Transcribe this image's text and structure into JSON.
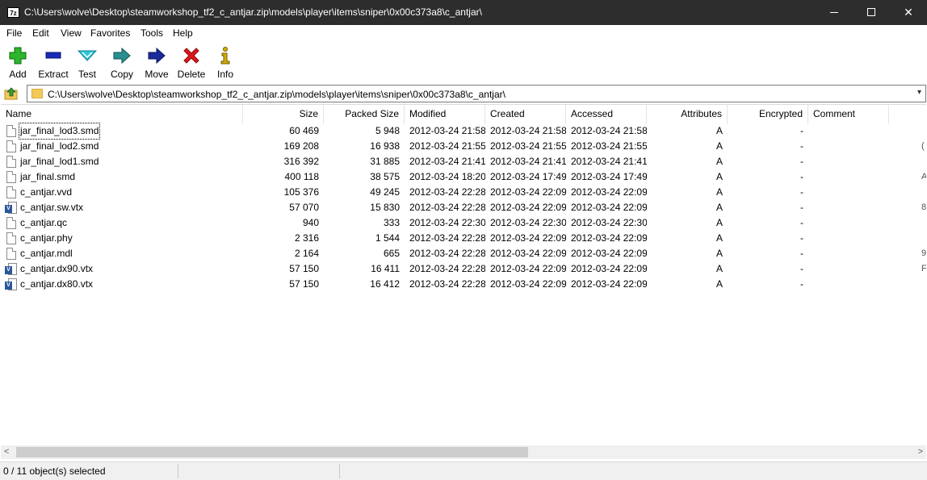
{
  "window": {
    "title": "C:\\Users\\wolve\\Desktop\\steamworkshop_tf2_c_antjar.zip\\models\\player\\items\\sniper\\0x00c373a8\\c_antjar\\",
    "app_icon_text": "7z"
  },
  "menu": [
    "File",
    "Edit",
    "View",
    "Favorites",
    "Tools",
    "Help"
  ],
  "toolbar": [
    {
      "label": "Add",
      "icon": "plus-icon",
      "color": "#2db52d"
    },
    {
      "label": "Extract",
      "icon": "minus-icon",
      "color": "#1a2bb8"
    },
    {
      "label": "Test",
      "icon": "check-icon",
      "color": "#2fc6d9"
    },
    {
      "label": "Copy",
      "icon": "copy-arrow-icon",
      "color": "#2a8f8f"
    },
    {
      "label": "Move",
      "icon": "move-arrow-icon",
      "color": "#1a2b9a"
    },
    {
      "label": "Delete",
      "icon": "delete-x-icon",
      "color": "#e0181c"
    },
    {
      "label": "Info",
      "icon": "info-icon",
      "color": "#d4b000"
    }
  ],
  "address": {
    "path": "C:\\Users\\wolve\\Desktop\\steamworkshop_tf2_c_antjar.zip\\models\\player\\items\\sniper\\0x00c373a8\\c_antjar\\"
  },
  "columns": [
    "Name",
    "Size",
    "Packed Size",
    "Modified",
    "Created",
    "Accessed",
    "Attributes",
    "Encrypted",
    "Comment"
  ],
  "files": [
    {
      "name": "jar_final_lod3.smd",
      "size": "60 469",
      "packed": "5 948",
      "modified": "2012-03-24 21:58",
      "created": "2012-03-24 21:58",
      "accessed": "2012-03-24 21:58",
      "attributes": "A",
      "encrypted": "-",
      "icon": "file-icon",
      "clip": ""
    },
    {
      "name": "jar_final_lod2.smd",
      "size": "169 208",
      "packed": "16 938",
      "modified": "2012-03-24 21:55",
      "created": "2012-03-24 21:55",
      "accessed": "2012-03-24 21:55",
      "attributes": "A",
      "encrypted": "-",
      "icon": "file-icon",
      "clip": "("
    },
    {
      "name": "jar_final_lod1.smd",
      "size": "316 392",
      "packed": "31 885",
      "modified": "2012-03-24 21:41",
      "created": "2012-03-24 21:41",
      "accessed": "2012-03-24 21:41",
      "attributes": "A",
      "encrypted": "-",
      "icon": "file-icon",
      "clip": ""
    },
    {
      "name": "jar_final.smd",
      "size": "400 118",
      "packed": "38 575",
      "modified": "2012-03-24 18:20",
      "created": "2012-03-24 17:49",
      "accessed": "2012-03-24 17:49",
      "attributes": "A",
      "encrypted": "-",
      "icon": "file-icon",
      "clip": "A"
    },
    {
      "name": "c_antjar.vvd",
      "size": "105 376",
      "packed": "49 245",
      "modified": "2012-03-24 22:28",
      "created": "2012-03-24 22:09",
      "accessed": "2012-03-24 22:09",
      "attributes": "A",
      "encrypted": "-",
      "icon": "file-icon",
      "clip": ""
    },
    {
      "name": "c_antjar.sw.vtx",
      "size": "57 070",
      "packed": "15 830",
      "modified": "2012-03-24 22:28",
      "created": "2012-03-24 22:09",
      "accessed": "2012-03-24 22:09",
      "attributes": "A",
      "encrypted": "-",
      "icon": "vs-icon",
      "clip": "8"
    },
    {
      "name": "c_antjar.qc",
      "size": "940",
      "packed": "333",
      "modified": "2012-03-24 22:30",
      "created": "2012-03-24 22:30",
      "accessed": "2012-03-24 22:30",
      "attributes": "A",
      "encrypted": "-",
      "icon": "file-icon",
      "clip": ""
    },
    {
      "name": "c_antjar.phy",
      "size": "2 316",
      "packed": "1 544",
      "modified": "2012-03-24 22:28",
      "created": "2012-03-24 22:09",
      "accessed": "2012-03-24 22:09",
      "attributes": "A",
      "encrypted": "-",
      "icon": "file-icon",
      "clip": ""
    },
    {
      "name": "c_antjar.mdl",
      "size": "2 164",
      "packed": "665",
      "modified": "2012-03-24 22:28",
      "created": "2012-03-24 22:09",
      "accessed": "2012-03-24 22:09",
      "attributes": "A",
      "encrypted": "-",
      "icon": "file-icon",
      "clip": "9"
    },
    {
      "name": "c_antjar.dx90.vtx",
      "size": "57 150",
      "packed": "16 411",
      "modified": "2012-03-24 22:28",
      "created": "2012-03-24 22:09",
      "accessed": "2012-03-24 22:09",
      "attributes": "A",
      "encrypted": "-",
      "icon": "vs-icon",
      "clip": "F"
    },
    {
      "name": "c_antjar.dx80.vtx",
      "size": "57 150",
      "packed": "16 412",
      "modified": "2012-03-24 22:28",
      "created": "2012-03-24 22:09",
      "accessed": "2012-03-24 22:09",
      "attributes": "A",
      "encrypted": "-",
      "icon": "vs-icon",
      "clip": ""
    }
  ],
  "status": {
    "selection": "0 / 11 object(s) selected"
  }
}
